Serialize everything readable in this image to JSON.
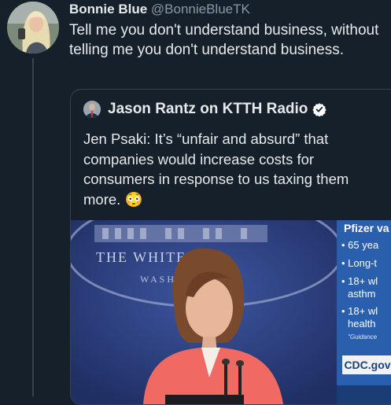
{
  "tweet": {
    "display_name": "Bonnie Blue",
    "handle": "@BonnieBlueTK",
    "text": "Tell me you don't understand business, without telling me you don't understand business."
  },
  "quote": {
    "display_name": "Jason Rantz on KTTH Radio",
    "text_before_emoji": "Jen Psaki: It’s “unfair and absurd” that companies would increase costs for consumers in response to us taxing them more. ",
    "emoji": "😳",
    "verified_icon": "verified-badge-icon"
  },
  "media": {
    "seal_line1": "THE WHITE",
    "seal_line2": "WASHINGT",
    "infobox": {
      "title": "Pfizer va",
      "items": [
        "65 yea",
        "Long-t",
        "18+ wl",
        "asthm",
        "18+ wl",
        "health"
      ],
      "guidance": "\"Guidance",
      "source": "CDC.gov"
    }
  },
  "colors": {
    "background": "#15202b",
    "text": "#e7e9ea",
    "secondary_text": "#8b98a5",
    "border": "#38444d",
    "verified": "#ffffff",
    "infobox_blue": "#2a5fae"
  }
}
